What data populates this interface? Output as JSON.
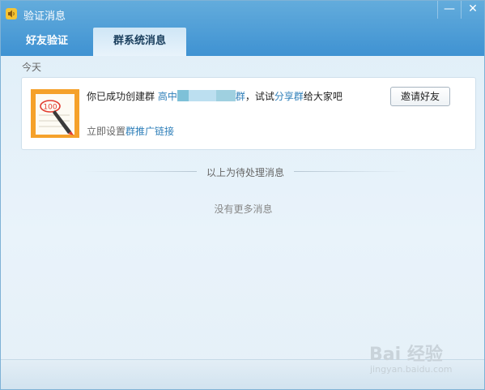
{
  "window": {
    "title": "验证消息",
    "minimize_glyph": "—",
    "close_glyph": "✕"
  },
  "tabs": [
    {
      "label": "好友验证",
      "active": false
    },
    {
      "label": "群系统消息",
      "active": true
    }
  ],
  "section": {
    "label": "今天"
  },
  "message": {
    "prefix": "你已成功创建群",
    "group_name_start": "高中",
    "group_name_end": "群",
    "middle": "，试试",
    "share_link": "分享群",
    "suffix": "给大家吧",
    "invite_button": "邀请好友",
    "promo_prefix": "立即设置",
    "promo_link": "群推广链接",
    "note_number": "100"
  },
  "divider_text": "以上为待处理消息",
  "no_more_text": "没有更多消息",
  "watermark": {
    "brand": "Bai 经验",
    "url": "jingyan.baidu.com"
  },
  "colors": {
    "titlebar": "#4a9bd6",
    "link": "#2f7fb9",
    "note_orange": "#f5a12a",
    "pen_red": "#e23b2f"
  }
}
